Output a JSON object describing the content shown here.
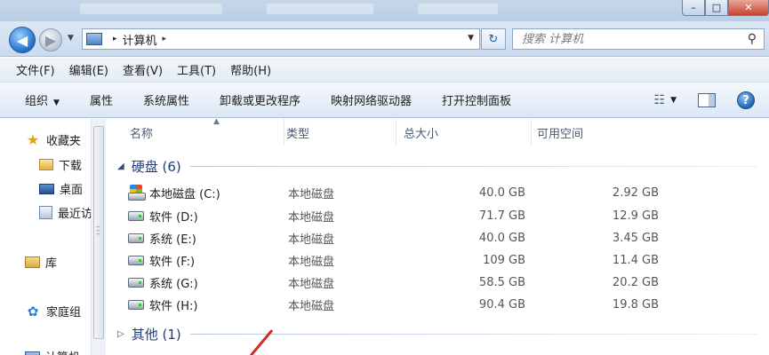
{
  "window": {
    "controls": {
      "minimize": "–",
      "maximize": "□",
      "close": "✕"
    }
  },
  "address": {
    "back": "◀",
    "forward": "▶",
    "sep": "▸",
    "crumb": "计算机",
    "drop": "▼",
    "refresh": "↻",
    "search_placeholder": "搜索 计算机",
    "search_icon": "⚲"
  },
  "menu": [
    "文件(F)",
    "编辑(E)",
    "查看(V)",
    "工具(T)",
    "帮助(H)"
  ],
  "commands": {
    "organize": "组织",
    "organize_arrow": "▼",
    "items": [
      "属性",
      "系统属性",
      "卸载或更改程序",
      "映射网络驱动器",
      "打开控制面板"
    ],
    "view_icon": "☷",
    "view_drop": "▼",
    "help": "?"
  },
  "nav": {
    "favorites": "收藏夹",
    "downloads": "下载",
    "desktop": "桌面",
    "recent": "最近访",
    "libraries": "库",
    "homegroup": "家庭组",
    "computer": "计算机",
    "icons": {
      "favorites": "★",
      "homegroup": "✿"
    }
  },
  "columns": {
    "name": "名称",
    "type": "类型",
    "total": "总大小",
    "free": "可用空间",
    "sort_arrow": "▲"
  },
  "groups": {
    "hdd": {
      "label": "硬盘 (6)",
      "tri": "◢"
    },
    "other": {
      "label": "其他 (1)",
      "tri": "▷"
    }
  },
  "drives": [
    {
      "name": "本地磁盘 (C:)",
      "type": "本地磁盘",
      "total": "40.0 GB",
      "free": "2.92 GB"
    },
    {
      "name": "软件 (D:)",
      "type": "本地磁盘",
      "total": "71.7 GB",
      "free": "12.9 GB"
    },
    {
      "name": "系统 (E:)",
      "type": "本地磁盘",
      "total": "40.0 GB",
      "free": "3.45 GB"
    },
    {
      "name": "软件 (F:)",
      "type": "本地磁盘",
      "total": "109 GB",
      "free": "11.4 GB"
    },
    {
      "name": "系统 (G:)",
      "type": "本地磁盘",
      "total": "58.5 GB",
      "free": "20.2 GB"
    },
    {
      "name": "软件 (H:)",
      "type": "本地磁盘",
      "total": "90.4 GB",
      "free": "19.8 GB"
    }
  ],
  "colors": {
    "accent": "#1e3c78",
    "annotation": "#d42a20"
  }
}
